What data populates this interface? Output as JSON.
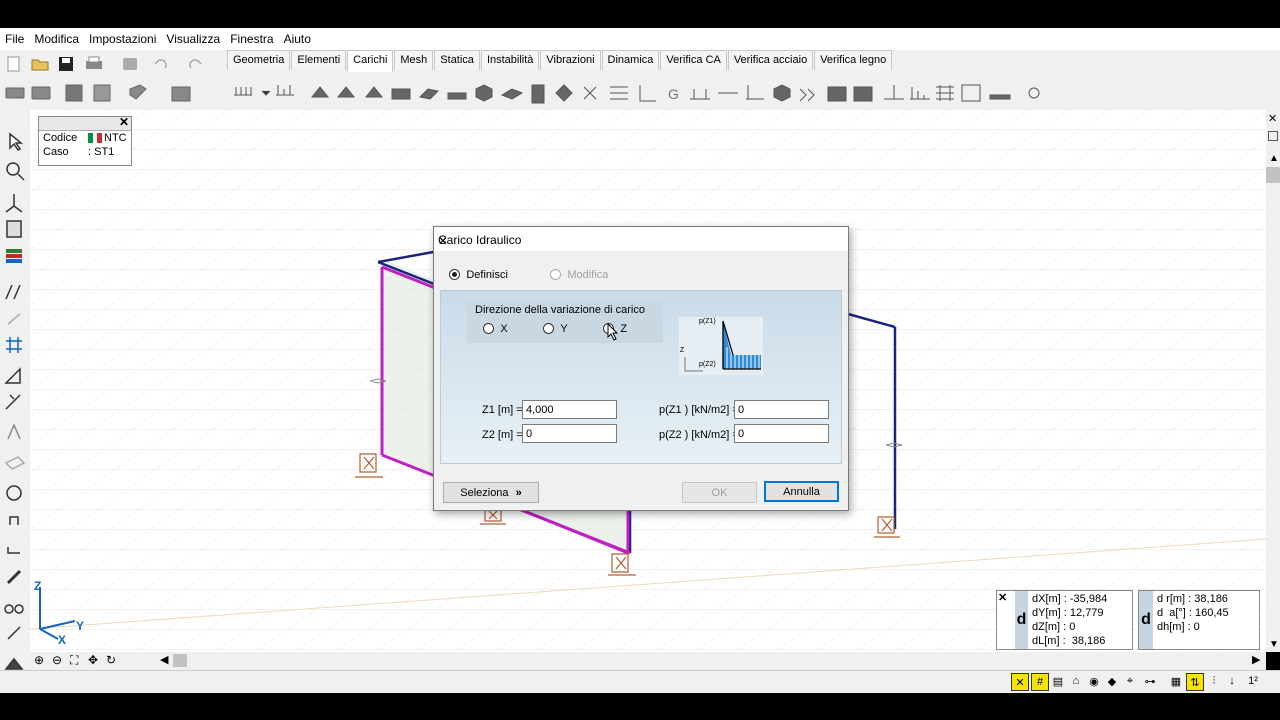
{
  "menu": [
    "File",
    "Modifica",
    "Impostazioni",
    "Visualizza",
    "Finestra",
    "Aiuto"
  ],
  "tabs": [
    "Geometria",
    "Elementi",
    "Carichi",
    "Mesh",
    "Statica",
    "Instabilità",
    "Vibrazioni",
    "Dinamica",
    "Verifica CA",
    "Verifica acciaio",
    "Verifica legno"
  ],
  "active_tab": "Carichi",
  "infobox": {
    "codice_label": "Codice",
    "codice_value": "NTC",
    "caso_label": "Caso",
    "caso_value": ": ST1"
  },
  "axes": {
    "z": "Z",
    "y": "Y",
    "x": "X"
  },
  "dialog": {
    "title": "Carico Idraulico",
    "definisci": "Definisci",
    "modifica": "Modifica",
    "direzione_label": "Direzione della variazione di carico",
    "dir_x": "X",
    "dir_y": "Y",
    "dir_z": "Z",
    "diagram_pz1": "p(Z1)",
    "diagram_pz2": "p(Z2)",
    "diagram_z": "Z",
    "z1_label": "Z1 [m] =",
    "z1_value": "4,000",
    "z2_label": "Z2 [m] =",
    "z2_value": "0",
    "pz1_label": "p(Z1 ) [kN/m2] =",
    "pz1_value": "0",
    "pz2_label": "p(Z2 ) [kN/m2] =",
    "pz2_value": "0",
    "seleziona": "Seleziona",
    "ok": "OK",
    "annulla": "Annulla"
  },
  "coords_left": {
    "d": "d",
    "dx": "dX[m] : -35,984",
    "dy": "dY[m] : 12,779",
    "dz": "dZ[m] : 0",
    "dl": "dL[m] :  38,186"
  },
  "coords_right": {
    "d": "d",
    "dr": "d r[m] : 38,186",
    "da": "d  a[°] : 160,45",
    "dh": "dh[m] : 0"
  },
  "status_right": "1²",
  "colors": {
    "frame_blue": "#1a237e",
    "panel_magenta": "#c020c0",
    "support_brown": "#b06030",
    "accent": "#0078d7"
  }
}
